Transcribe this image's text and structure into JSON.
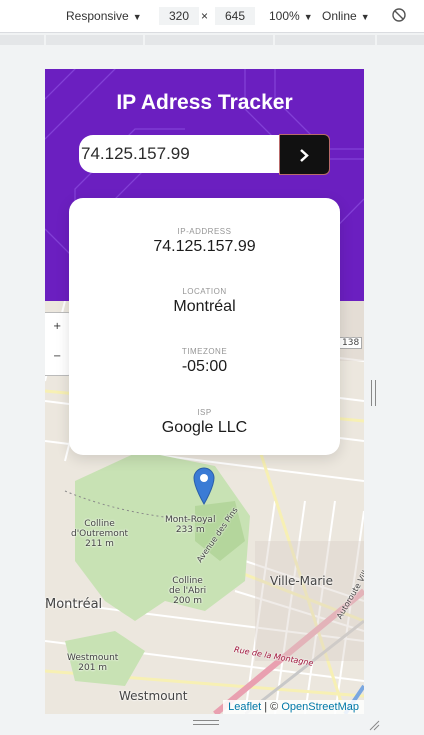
{
  "devtools": {
    "device": "Responsive",
    "width": "320",
    "times": "×",
    "height": "645",
    "zoom": "100%",
    "throttle": "Online",
    "rotate_icon": "rotate-icon"
  },
  "app": {
    "title": "IP Adress Tracker",
    "search_value": "74.125.157.99",
    "submit_icon": "chevron-right-icon",
    "colors": {
      "header_bg": "#6b1fc0",
      "button_bg": "#111111"
    }
  },
  "info": {
    "ip_label": "IP-ADDRESS",
    "ip_value": "74.125.157.99",
    "location_label": "LOCATION",
    "location_value": "Montréal",
    "timezone_label": "TIMEZONE",
    "timezone_value": "-05:00",
    "isp_label": "ISP",
    "isp_value": "Google LLC"
  },
  "map": {
    "zoom_in": "+",
    "zoom_out": "−",
    "route_badge": "138",
    "labels": {
      "colline_outremont": "Colline\nd'Outremont\n211 m",
      "mont_royal": "Mont-Royal\n233 m",
      "colline_abri": "Colline\nde l'Abri\n200 m",
      "ville_marie": "Ville-Marie",
      "montreal": "Montréal",
      "westmount_hill": "Westmount\n201 m",
      "westmount": "Westmount",
      "avenue_des_pins": "Avenue des Pins",
      "rue_montagne": "Rue de la Montagne",
      "autoroute": "Autoroute Ville-Marie"
    },
    "attribution_leaflet": "Leaflet",
    "attribution_sep": " | © ",
    "attribution_osm": "OpenStreetMap",
    "marker_icon": "map-marker-icon"
  }
}
